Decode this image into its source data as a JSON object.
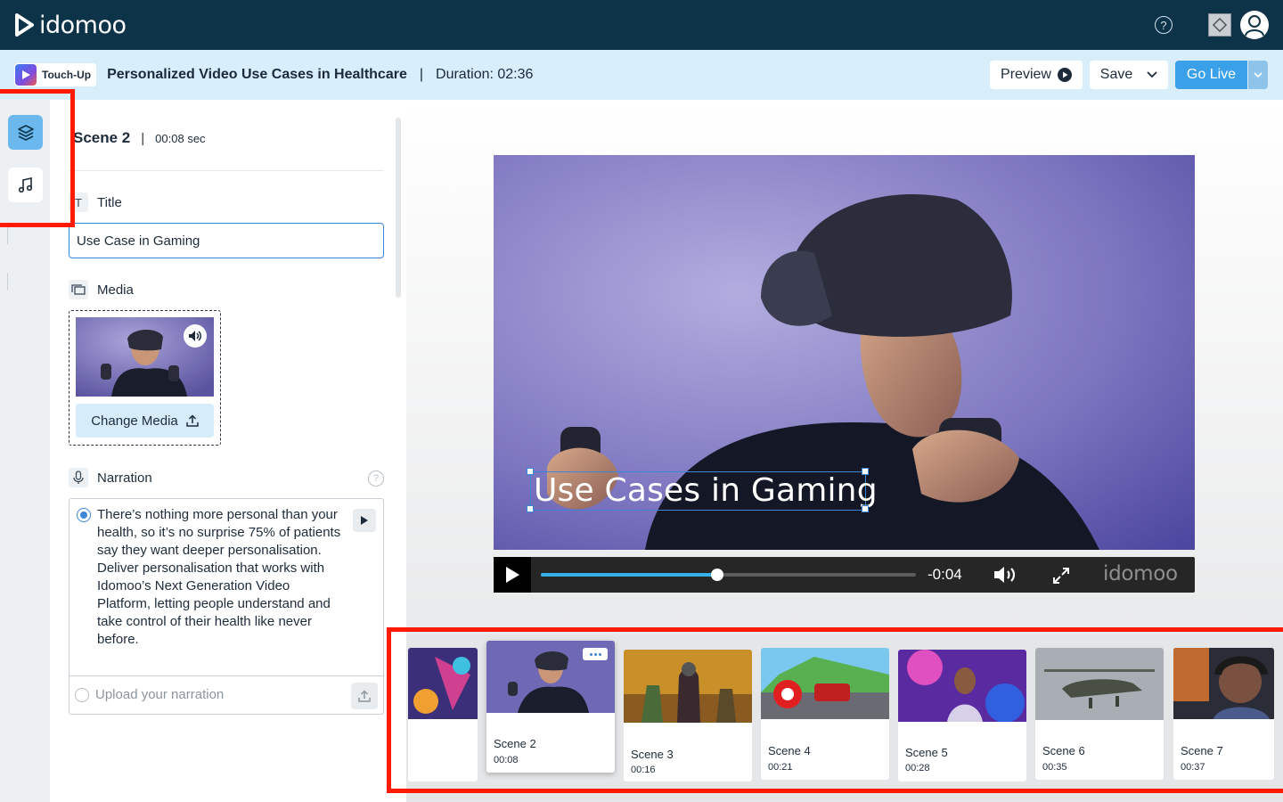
{
  "topbar": {
    "logo_text": "idomoo",
    "help_icon": "question-circle-icon",
    "app_icon": "app-switcher-icon",
    "avatar_icon": "user-avatar-icon"
  },
  "subbar": {
    "badge_label": "Touch-Up",
    "project_title": "Personalized Video Use Cases in Healthcare",
    "separator": "|",
    "duration": "Duration: 02:36",
    "preview_label": "Preview",
    "save_label": "Save",
    "golive_label": "Go Live"
  },
  "rail": {
    "items": [
      {
        "name": "layers",
        "active": true
      },
      {
        "name": "music",
        "active": false
      }
    ]
  },
  "panel": {
    "scene_name": "Scene 2",
    "scene_sep": "|",
    "scene_time": "00:08 sec",
    "title_label": "Title",
    "title_value": "Use Case in Gaming",
    "media_label": "Media",
    "change_media_label": "Change Media",
    "narration_label": "Narration",
    "narration_text": "There’s nothing more personal than your health, so it’s no surprise 75% of patients say they want deeper personalisation. Deliver personalisation that works with Idomoo’s Next Generation Video Platform, letting people understand and take control of their health like never before.",
    "upload_label": "Upload your narration"
  },
  "player": {
    "overlay_title": "Use Cases in Gaming",
    "remaining": "-0:04",
    "progress": 0.47,
    "watermark": "idomoo"
  },
  "scenes": [
    {
      "name": "",
      "time": ""
    },
    {
      "name": "Scene 2",
      "time": "00:08"
    },
    {
      "name": "Scene 3",
      "time": "00:16"
    },
    {
      "name": "Scene 4",
      "time": "00:21"
    },
    {
      "name": "Scene 5",
      "time": "00:28"
    },
    {
      "name": "Scene 6",
      "time": "00:35"
    },
    {
      "name": "Scene 7",
      "time": "00:37"
    }
  ],
  "colors": {
    "topbar": "#0d3349",
    "subbar": "#d9eefb",
    "accent": "#3aa0ea",
    "highlight": "#ff1a00"
  }
}
